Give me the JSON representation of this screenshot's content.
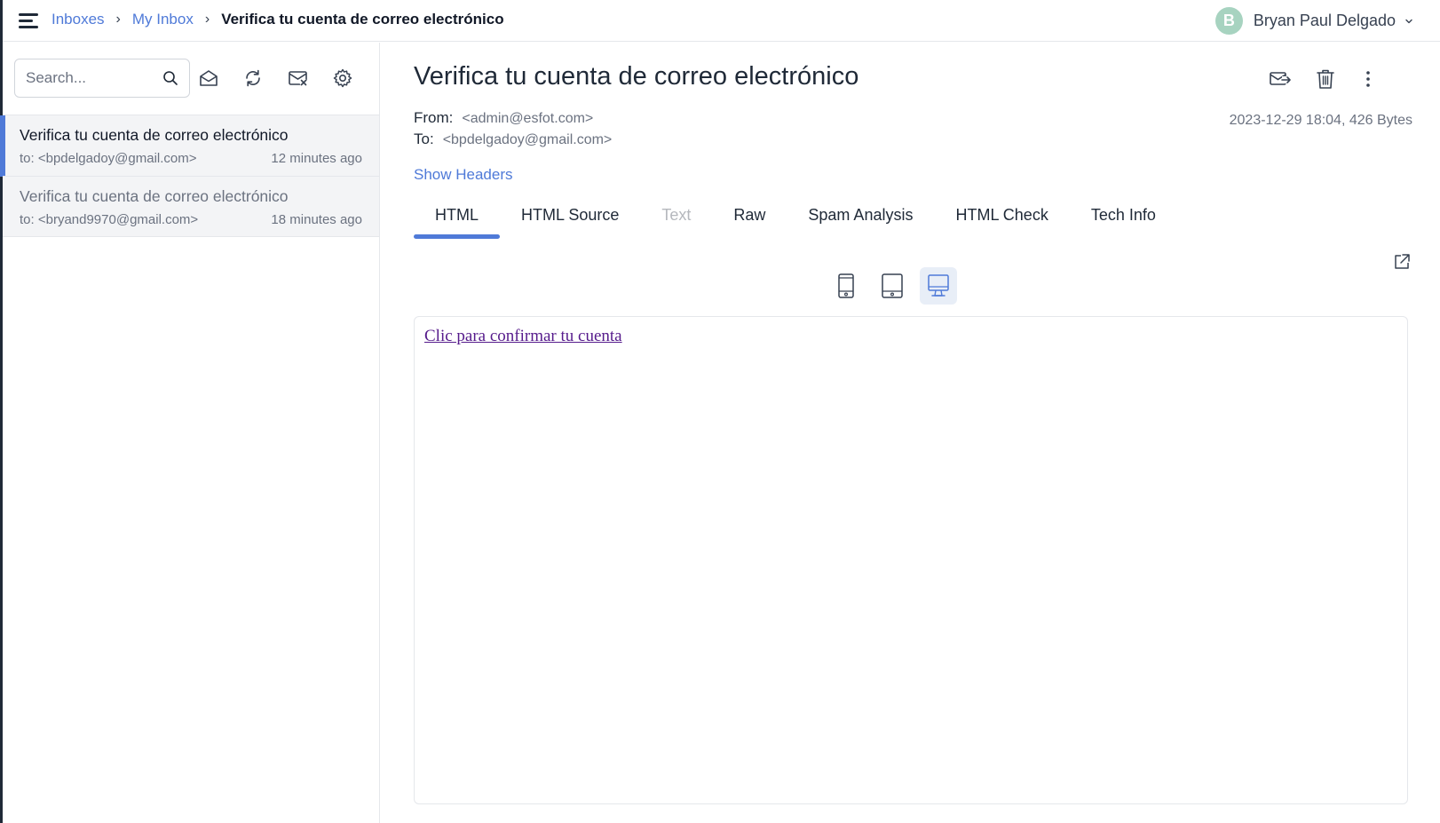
{
  "header": {
    "breadcrumb": {
      "inboxes": "Inboxes",
      "my_inbox": "My Inbox",
      "current": "Verifica tu cuenta de correo electrónico",
      "separator": "›"
    },
    "user": {
      "initial": "B",
      "name": "Bryan Paul Delgado",
      "avatar_color": "#a7d3c0"
    }
  },
  "sidebar": {
    "search": {
      "placeholder": "Search...",
      "value": ""
    },
    "toolbar_icons": [
      "mark-read-icon",
      "refresh-icon",
      "clear-inbox-icon",
      "settings-icon"
    ],
    "messages": [
      {
        "subject": "Verifica tu cuenta de correo electrónico",
        "to": "to: <bpdelgadoy@gmail.com>",
        "time": "12 minutes ago",
        "selected": true
      },
      {
        "subject": "Verifica tu cuenta de correo electrónico",
        "to": "to: <bryand9970@gmail.com>",
        "time": "18 minutes ago",
        "selected": false
      }
    ]
  },
  "message": {
    "subject": "Verifica tu cuenta de correo electrónico",
    "from_label": "From:",
    "from": "<admin@esfot.com>",
    "to_label": "To:",
    "to": "<bpdelgadoy@gmail.com>",
    "date_size": "2023-12-29 18:04, 426 Bytes",
    "show_headers": "Show Headers",
    "actions": [
      "forward-icon",
      "trash-icon",
      "more-vertical-icon"
    ]
  },
  "tabs": [
    {
      "label": "HTML",
      "active": true,
      "disabled": false
    },
    {
      "label": "HTML Source",
      "active": false,
      "disabled": false
    },
    {
      "label": "Text",
      "active": false,
      "disabled": true
    },
    {
      "label": "Raw",
      "active": false,
      "disabled": false
    },
    {
      "label": "Spam Analysis",
      "active": false,
      "disabled": false
    },
    {
      "label": "HTML Check",
      "active": false,
      "disabled": false
    },
    {
      "label": "Tech Info",
      "active": false,
      "disabled": false
    }
  ],
  "preview": {
    "devices": [
      "phone-icon",
      "tablet-icon",
      "desktop-icon"
    ],
    "active_device": "desktop",
    "body_link": "Clic para confirmar tu cuenta"
  },
  "colors": {
    "accent": "#4f7ad8",
    "visited_link": "#551a8b",
    "text": "#1f2937",
    "muted": "#6b7280"
  }
}
